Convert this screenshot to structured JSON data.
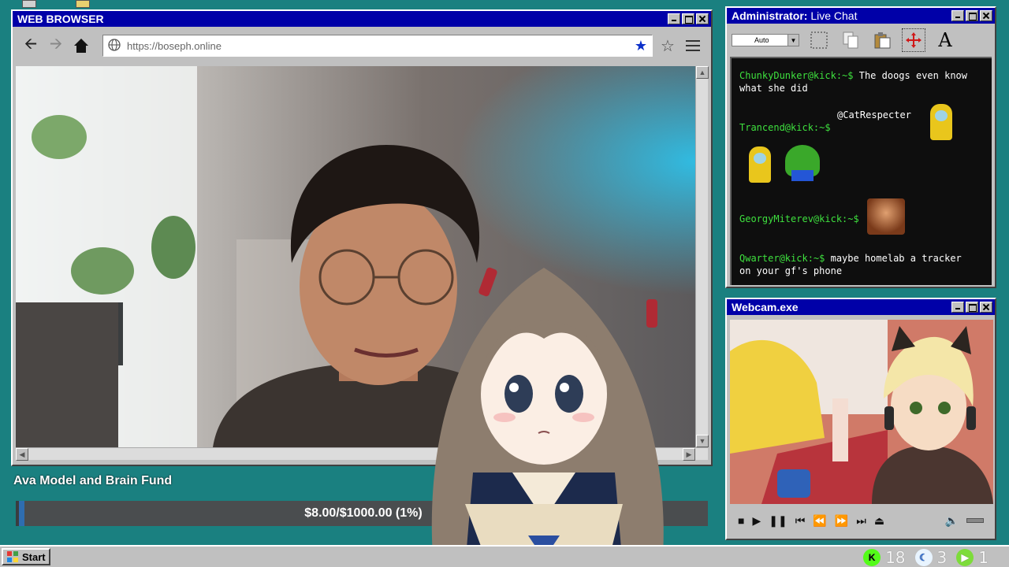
{
  "browser": {
    "title": "WEB BROWSER",
    "url": "https://boseph.online",
    "back_icon": "arrow-left-icon",
    "forward_icon": "arrow-right-icon",
    "home_icon": "home-icon",
    "globe_icon": "globe-icon",
    "bookmark_icon": "star-filled-icon",
    "favorite_icon": "star-outline-icon",
    "menu_icon": "hamburger-menu-icon"
  },
  "chat": {
    "title_bold": "Administrator:",
    "title_rest": " Live Chat",
    "font_select": "Auto",
    "messages": [
      {
        "user": "ChunkyDunker@kick:~$",
        "text": " The doogs even know what she did"
      },
      {
        "user": "",
        "text": "@CatRespecter"
      },
      {
        "user": "Trancend@kick:~$",
        "text": ""
      },
      {
        "user": "GeorgyMiterev@kick:~$",
        "text": ""
      },
      {
        "user": "Qwarter@kick:~$",
        "text": " maybe homelab a tracker on your gf's phone"
      }
    ]
  },
  "webcam": {
    "title": "Webcam.exe"
  },
  "fund": {
    "title": "Ava Model and Brain Fund",
    "progress_text": "$8.00/$1000.00 (1%)",
    "raised": 8.0,
    "goal": 1000.0,
    "percent": 1
  },
  "taskbar": {
    "start_label": "Start",
    "tray": [
      {
        "icon": "kick-icon",
        "count": "18",
        "color": "#53fc18"
      },
      {
        "icon": "moon-icon",
        "count": "3",
        "color": "#e8f4ff"
      },
      {
        "icon": "play-icon",
        "count": "1",
        "color": "#7ddc3a"
      }
    ]
  },
  "colors": {
    "desktop": "#1a8080",
    "titlebar": "#0000a8",
    "chat_username": "#3ee03e"
  }
}
